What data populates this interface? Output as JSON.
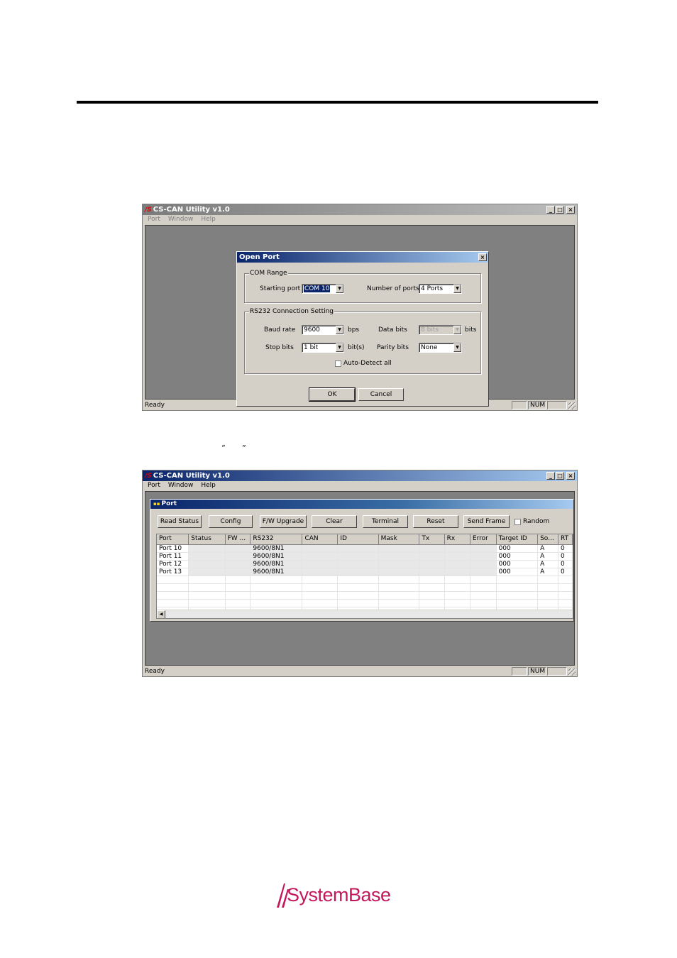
{
  "page": {
    "open_quote": "“",
    "close_quote": "”",
    "logo_text": "SystemBase"
  },
  "window1": {
    "title": "CS-CAN Utility v1.0",
    "menu": [
      "Port",
      "Window",
      "Help"
    ],
    "status_text": "Ready",
    "status_num": "NUM",
    "dialog": {
      "title": "Open Port",
      "com_range": {
        "group_label": "COM Range",
        "starting_port_label": "Starting port",
        "starting_port_value": "COM 10",
        "number_of_ports_label": "Number of ports",
        "number_of_ports_value": "4 Ports"
      },
      "rs232": {
        "group_label": "RS232 Connection Setting",
        "baud_rate_label": "Baud rate",
        "baud_rate_value": "9600",
        "baud_rate_unit": "bps",
        "data_bits_label": "Data bits",
        "data_bits_value": "8 bits",
        "data_bits_unit": "bits",
        "stop_bits_label": "Stop bits",
        "stop_bits_value": "1 bit",
        "stop_bits_unit": "bit(s)",
        "parity_bits_label": "Parity bits",
        "parity_bits_value": "None",
        "auto_detect_label": "Auto-Detect all"
      },
      "ok_label": "OK",
      "cancel_label": "Cancel"
    }
  },
  "window2": {
    "title": "CS-CAN Utility v1.0",
    "menu": [
      "Port",
      "Window",
      "Help"
    ],
    "status_text": "Ready",
    "status_num": "NUM",
    "child": {
      "title": "Port",
      "buttons": [
        "Read Status",
        "Config",
        "F/W Upgrade",
        "Clear",
        "Terminal",
        "Reset",
        "Send Frame"
      ],
      "random_label": "Random",
      "columns": [
        "Port",
        "Status",
        "FW ...",
        "RS232",
        "CAN",
        "ID",
        "Mask",
        "Tx",
        "Rx",
        "Error",
        "Target ID",
        "So...",
        "RT"
      ],
      "rows": [
        [
          "Port 10",
          "",
          "",
          "9600/8N1",
          "",
          "",
          "",
          "",
          "",
          "",
          "000",
          "A",
          "0"
        ],
        [
          "Port 11",
          "",
          "",
          "9600/8N1",
          "",
          "",
          "",
          "",
          "",
          "",
          "000",
          "A",
          "0"
        ],
        [
          "Port 12",
          "",
          "",
          "9600/8N1",
          "",
          "",
          "",
          "",
          "",
          "",
          "000",
          "A",
          "0"
        ],
        [
          "Port 13",
          "",
          "",
          "9600/8N1",
          "",
          "",
          "",
          "",
          "",
          "",
          "000",
          "A",
          "0"
        ]
      ]
    }
  }
}
